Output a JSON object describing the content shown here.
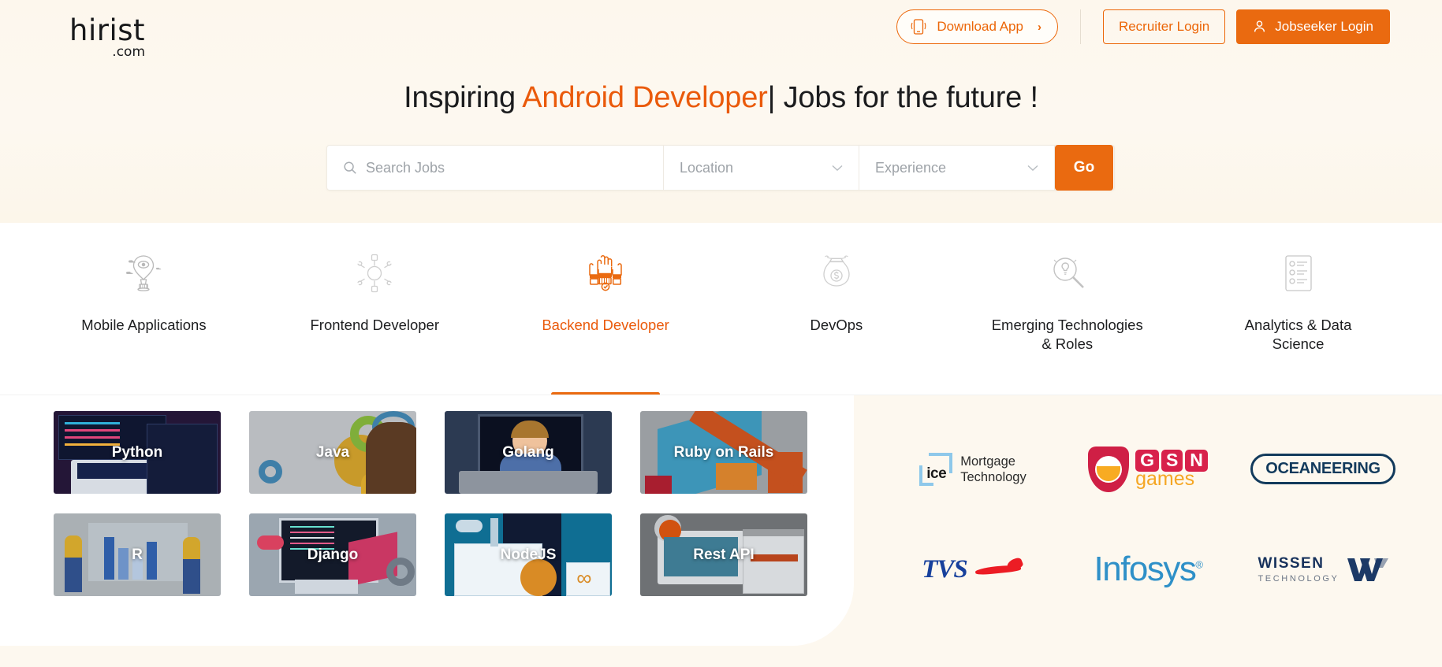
{
  "brand": {
    "logo_main": "hirist",
    "logo_sub": ".com",
    "accent_color": "#ea6a10",
    "hero_bg_color": "#fdf8ef"
  },
  "header": {
    "download_app_label": "Download App",
    "download_app_chevron": "›",
    "recruiter_login_label": "Recruiter Login",
    "jobseeker_login_label": "Jobseeker Login",
    "icons": {
      "mobile": "mobile-phone-icon",
      "user": "user-icon"
    }
  },
  "hero": {
    "headline_prefix": "Inspiring ",
    "headline_accent": "Android Developer",
    "headline_suffix": "| Jobs for the future !",
    "search": {
      "search_placeholder": "Search Jobs",
      "location_placeholder": "Location",
      "experience_placeholder": "Experience",
      "go_label": "Go",
      "caret": "⌄"
    }
  },
  "categories": [
    {
      "label": "Mobile Applications",
      "icon": "hot-air-balloon-idea-icon",
      "active": false
    },
    {
      "label": "Frontend Developer",
      "icon": "gear-hub-network-icon",
      "active": false
    },
    {
      "label": "Backend Developer",
      "icon": "raised-hands-icon",
      "active": true
    },
    {
      "label": "DevOps",
      "icon": "money-bag-dollar-icon",
      "active": false
    },
    {
      "label": "Emerging Technologies & Roles",
      "icon": "magnifier-search-idea-icon",
      "active": false
    },
    {
      "label": "Analytics & Data Science",
      "icon": "document-report-icon",
      "active": false
    }
  ],
  "skill_cards": [
    {
      "label": "Python",
      "art": "art-python"
    },
    {
      "label": "Java",
      "art": "art-java"
    },
    {
      "label": "Golang",
      "art": "art-golang"
    },
    {
      "label": "Ruby on Rails",
      "art": "art-ruby"
    },
    {
      "label": "R",
      "art": "art-r"
    },
    {
      "label": "Django",
      "art": "art-django"
    },
    {
      "label": "NodeJS",
      "art": "art-node"
    },
    {
      "label": "Rest API",
      "art": "art-rest"
    }
  ],
  "companies": [
    {
      "name": "ICE Mortgage Technology",
      "line1": "Mortgage",
      "line2": "Technology",
      "mark_text": "ice",
      "trademark": "™"
    },
    {
      "name": "GSN games",
      "letters": [
        "G",
        "S",
        "N"
      ],
      "word": "games"
    },
    {
      "name": "OCEANEERING",
      "word": "OCEANEERING"
    },
    {
      "name": "TVS",
      "word": "TVS"
    },
    {
      "name": "Infosys",
      "word": "Infosys",
      "registered": "®"
    },
    {
      "name": "Wissen Technology",
      "line1": "WISSEN",
      "line2": "TECHNOLOGY",
      "mark": "W"
    }
  ]
}
